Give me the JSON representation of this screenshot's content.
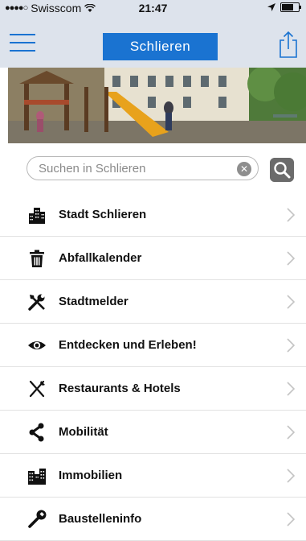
{
  "status_bar": {
    "carrier": "Swisscom",
    "time": "21:47"
  },
  "header": {
    "title": "Schlieren"
  },
  "search": {
    "placeholder": "Suchen in Schlieren"
  },
  "menu_items": [
    {
      "label": "Stadt Schlieren",
      "icon": "buildings-icon"
    },
    {
      "label": "Abfallkalender",
      "icon": "trash-icon"
    },
    {
      "label": "Stadtmelder",
      "icon": "tools-icon"
    },
    {
      "label": "Entdecken und Erleben!",
      "icon": "eye-icon"
    },
    {
      "label": "Restaurants & Hotels",
      "icon": "cutlery-icon"
    },
    {
      "label": "Mobilität",
      "icon": "share-nodes-icon"
    },
    {
      "label": "Immobilien",
      "icon": "buildings-icon"
    },
    {
      "label": "Baustelleninfo",
      "icon": "wrench-icon"
    }
  ],
  "colors": {
    "accent": "#1a73d1",
    "bar_background": "#dde3ec"
  }
}
